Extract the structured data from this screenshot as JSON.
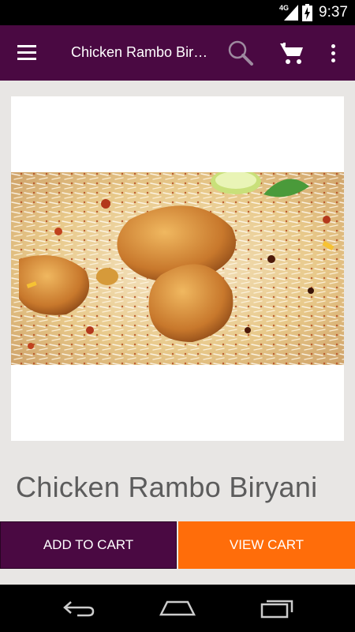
{
  "status_bar": {
    "network": "4G",
    "time": "9:37"
  },
  "app_bar": {
    "title": "Chicken Rambo Biryani",
    "menu_icon": "hamburger-menu-icon",
    "search_icon": "search-icon",
    "cart_icon": "shopping-cart-icon",
    "more_icon": "more-vertical-icon"
  },
  "product": {
    "name": "Chicken Rambo Biryani",
    "image": "chicken-biryani-photo"
  },
  "actions": {
    "add_to_cart": "ADD TO CART",
    "view_cart": "VIEW CART"
  },
  "nav_bar": {
    "back_icon": "back-icon",
    "home_icon": "home-icon",
    "recents_icon": "recent-apps-icon"
  },
  "colors": {
    "primary": "#4a0942",
    "accent": "#ff6d0a",
    "background": "#e8e6e4",
    "product_name_text": "#5c5c5c"
  }
}
